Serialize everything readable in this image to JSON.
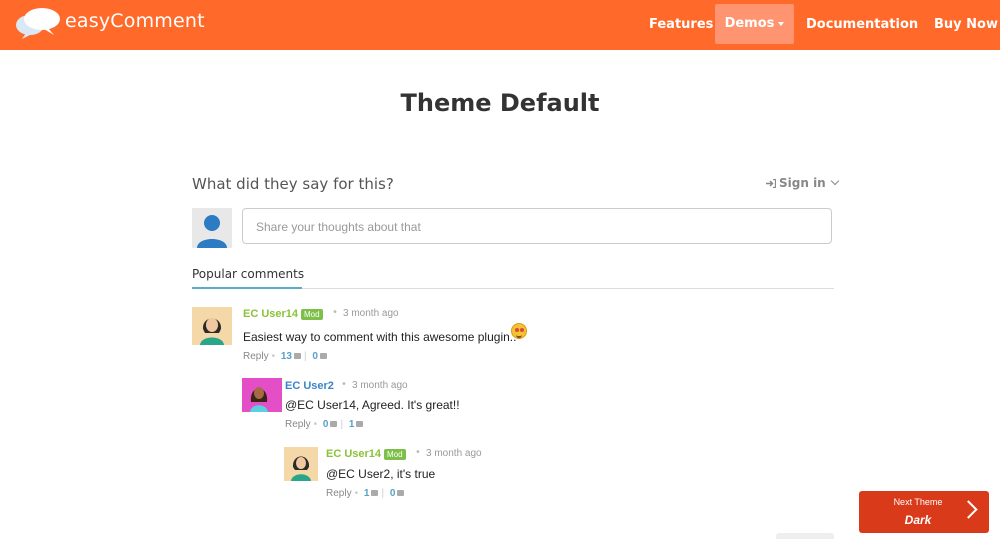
{
  "nav": {
    "brand": "easyComment",
    "items": [
      {
        "label": "Features"
      },
      {
        "label": "Demos"
      },
      {
        "label": "Documentation"
      },
      {
        "label": "Buy Now"
      }
    ]
  },
  "page": {
    "title": "Theme Default"
  },
  "widget": {
    "question": "What did they say for this?",
    "signin": "Sign in",
    "input_placeholder": "Share your thoughts about that",
    "tab": "Popular comments"
  },
  "comments": [
    {
      "user": "EC User14",
      "badge": "Mod",
      "time": "3 month ago",
      "text": "Easiest way to comment with this awesome plugin..",
      "reply": "Reply",
      "up": "13",
      "down": "0"
    },
    {
      "user": "EC User2",
      "badge": "",
      "time": "3 month ago",
      "text": "@EC User14, Agreed. It's great!!",
      "reply": "Reply",
      "up": "0",
      "down": "1"
    },
    {
      "user": "EC User14",
      "badge": "Mod",
      "time": "3 month ago",
      "text": "@EC User2, it's true",
      "reply": "Reply",
      "up": "1",
      "down": "0"
    }
  ],
  "next_theme": {
    "label": "Next Theme",
    "value": "Dark"
  },
  "colors": {
    "accent": "#ff6a2b",
    "mod_green": "#7cc04a",
    "user_green": "#8ac23a",
    "user_blue": "#3a86c8",
    "cta_red": "#d93a1a"
  }
}
